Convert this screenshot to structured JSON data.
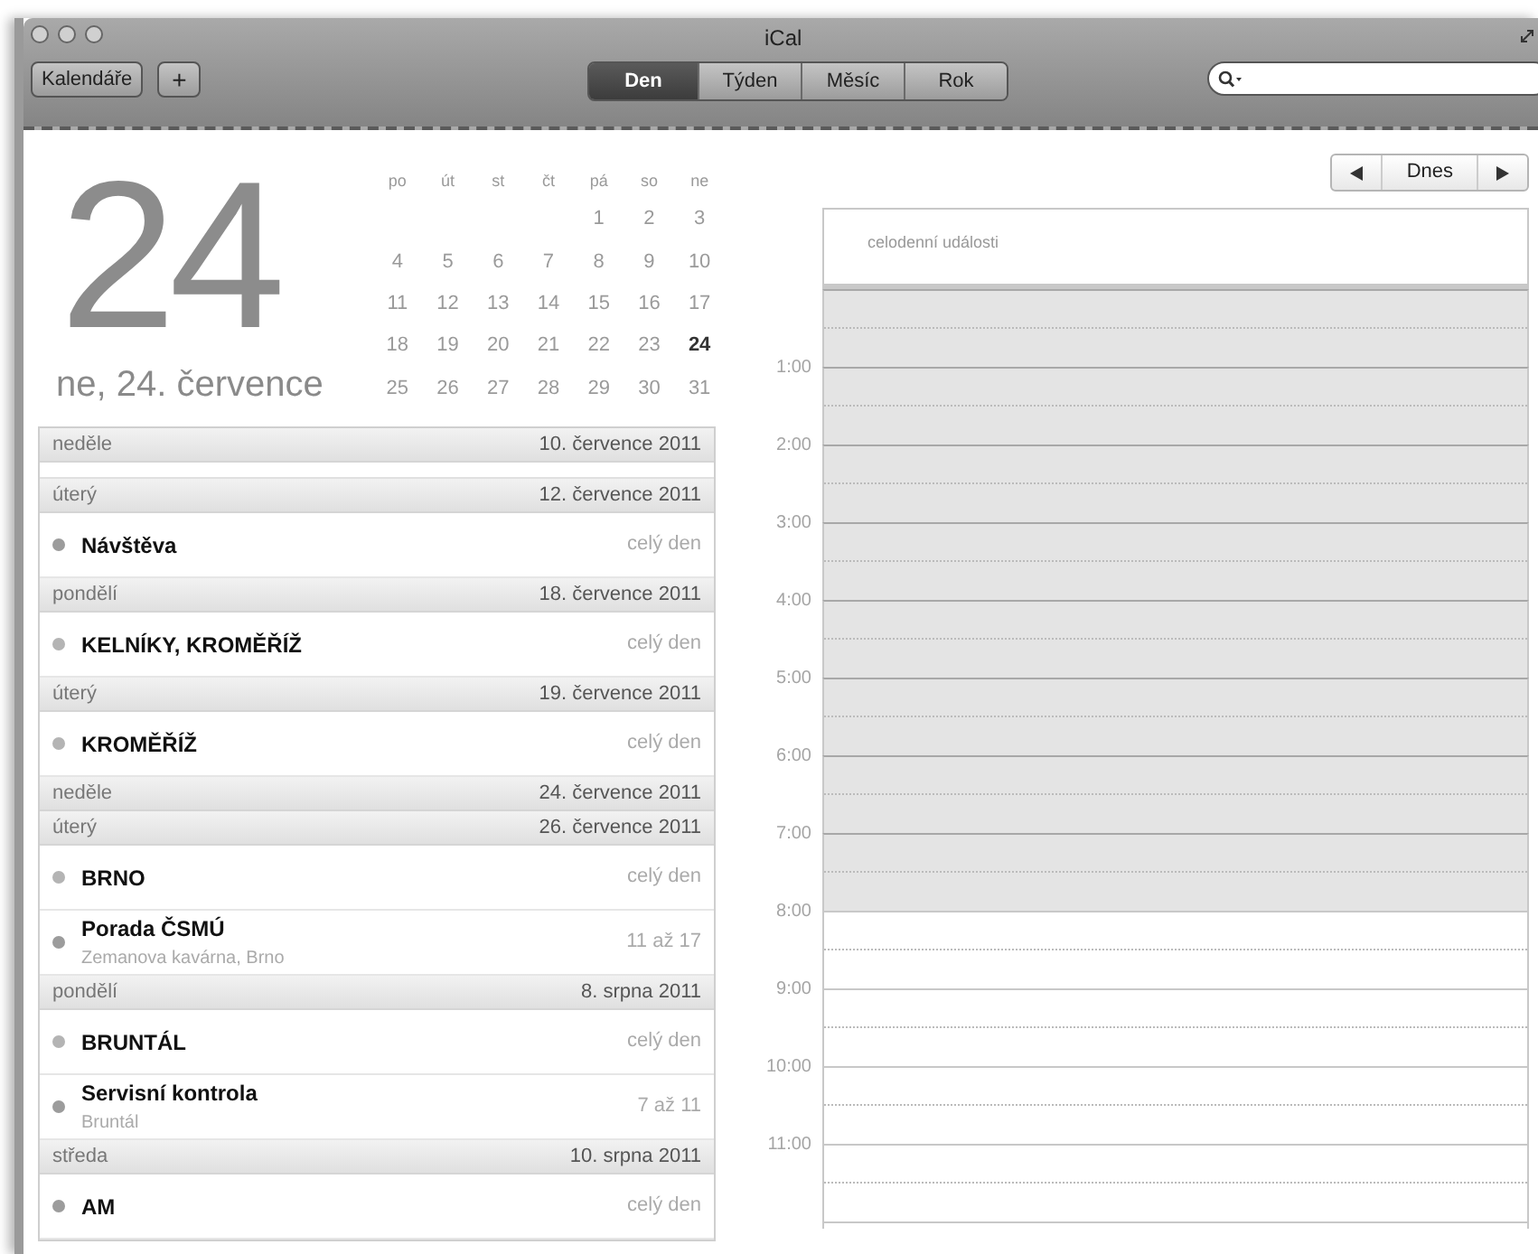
{
  "window": {
    "title": "iCal"
  },
  "toolbar": {
    "calendars_button": "Kalendáře",
    "add_button": "+",
    "view_tabs": [
      {
        "label": "Den",
        "selected": true
      },
      {
        "label": "Týden",
        "selected": false
      },
      {
        "label": "Měsíc",
        "selected": false
      },
      {
        "label": "Rok",
        "selected": false
      }
    ],
    "search_field": {
      "kind": "search"
    }
  },
  "big_date": {
    "day": "24",
    "caption": "ne, 24. července"
  },
  "mini_calendar": {
    "weekdays": [
      "po",
      "út",
      "st",
      "čt",
      "pá",
      "so",
      "ne"
    ],
    "weeks": [
      [
        {
          "day": "1",
          "selected": false
        },
        {
          "day": "2",
          "selected": false
        },
        {
          "day": "3",
          "selected": false
        }
      ],
      [
        {
          "day": "4",
          "selected": false
        },
        {
          "day": "5",
          "selected": false
        },
        {
          "day": "6",
          "selected": false
        },
        {
          "day": "7",
          "selected": false
        },
        {
          "day": "8",
          "selected": false
        },
        {
          "day": "9",
          "selected": false
        },
        {
          "day": "10",
          "selected": false
        }
      ],
      [
        {
          "day": "11",
          "selected": false
        },
        {
          "day": "12",
          "selected": false
        },
        {
          "day": "13",
          "selected": false
        },
        {
          "day": "14",
          "selected": false
        },
        {
          "day": "15",
          "selected": false
        },
        {
          "day": "16",
          "selected": false
        },
        {
          "day": "17",
          "selected": false
        }
      ],
      [
        {
          "day": "18",
          "selected": false
        },
        {
          "day": "19",
          "selected": false
        },
        {
          "day": "20",
          "selected": false
        },
        {
          "day": "21",
          "selected": false
        },
        {
          "day": "22",
          "selected": false
        },
        {
          "day": "23",
          "selected": false
        },
        {
          "day": "24",
          "selected": true
        }
      ],
      [
        {
          "day": "25",
          "selected": false
        },
        {
          "day": "26",
          "selected": false
        },
        {
          "day": "27",
          "selected": false
        },
        {
          "day": "28",
          "selected": false
        },
        {
          "day": "29",
          "selected": false
        },
        {
          "day": "30",
          "selected": false
        },
        {
          "day": "31",
          "selected": false
        }
      ]
    ]
  },
  "event_list": [
    {
      "weekday": "neděle",
      "date": "10. července 2011"
    },
    {
      "weekday": "úterý",
      "date": "12. července 2011",
      "events": [
        {
          "title": "Návštěva",
          "time": "celý den",
          "color": "#9c9c9c"
        }
      ]
    },
    {
      "weekday": "pondělí",
      "date": "18. července 2011",
      "events": [
        {
          "title": "KELNÍKY, KROMĚŘÍŽ",
          "time": "celý den",
          "color": "#b4b4b4"
        }
      ]
    },
    {
      "weekday": "úterý",
      "date": "19. července 2011",
      "events": [
        {
          "title": "KROMĚŘÍŽ",
          "time": "celý den",
          "color": "#b4b4b4"
        }
      ]
    },
    {
      "weekday": "neděle",
      "date": "24. července 2011"
    },
    {
      "weekday": "úterý",
      "date": "26. července 2011",
      "events": [
        {
          "title": "BRNO",
          "time": "celý den",
          "color": "#b4b4b4"
        },
        {
          "title": "Porada ČSMÚ",
          "location": "Zemanova kavárna, Brno",
          "time": "11 až 17",
          "color": "#9c9c9c"
        }
      ]
    },
    {
      "weekday": "pondělí",
      "date": "8. srpna 2011",
      "events": [
        {
          "title": "BRUNTÁL",
          "time": "celý den",
          "color": "#b4b4b4"
        },
        {
          "title": "Servisní kontrola",
          "location": "Bruntál",
          "time": "7 až 11",
          "color": "#9c9c9c"
        }
      ]
    },
    {
      "weekday": "středa",
      "date": "10. srpna 2011",
      "events": [
        {
          "title": "AM",
          "time": "celý den",
          "color": "#9c9c9c"
        }
      ]
    }
  ],
  "day_view": {
    "today_button": "Dnes",
    "all_day_label": "celodenní události",
    "hours": [
      {
        "shaded": true
      },
      {
        "label": "1:00",
        "shaded": true
      },
      {
        "label": "2:00",
        "shaded": true
      },
      {
        "label": "3:00",
        "shaded": true
      },
      {
        "label": "4:00",
        "shaded": true
      },
      {
        "label": "5:00",
        "shaded": true
      },
      {
        "label": "6:00",
        "shaded": true
      },
      {
        "label": "7:00",
        "shaded": true
      },
      {
        "label": "8:00",
        "shaded": false
      },
      {
        "label": "9:00",
        "shaded": false
      },
      {
        "label": "10:00",
        "shaded": false
      },
      {
        "label": "11:00",
        "shaded": false
      },
      {
        "shaded": false
      }
    ]
  }
}
